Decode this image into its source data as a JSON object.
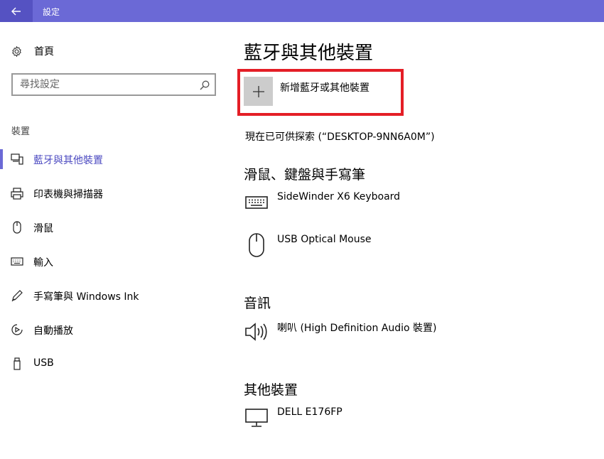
{
  "window": {
    "title": "設定",
    "back_icon": "arrow-left-icon"
  },
  "sidebar": {
    "home_label": "首頁",
    "search_placeholder": "尋找設定",
    "section_label": "裝置",
    "items": [
      {
        "label": "藍牙與其他裝置",
        "icon": "bluetooth-devices-icon",
        "active": true
      },
      {
        "label": "印表機與掃描器",
        "icon": "printer-icon",
        "active": false
      },
      {
        "label": "滑鼠",
        "icon": "mouse-icon",
        "active": false
      },
      {
        "label": "輸入",
        "icon": "keyboard-icon",
        "active": false
      },
      {
        "label": "手寫筆與 Windows Ink",
        "icon": "pen-icon",
        "active": false
      },
      {
        "label": "自動播放",
        "icon": "autoplay-icon",
        "active": false
      },
      {
        "label": "USB",
        "icon": "usb-icon",
        "active": false
      }
    ]
  },
  "main": {
    "title": "藍牙與其他裝置",
    "add_device_label": "新增藍牙或其他裝置",
    "discoverable_text": "現在已可供探索 (“DESKTOP-9NN6A0M”)",
    "sections": [
      {
        "heading": "滑鼠、鍵盤與手寫筆",
        "devices": [
          {
            "name": "SideWinder X6 Keyboard",
            "icon": "keyboard-icon"
          },
          {
            "name": "USB Optical Mouse",
            "icon": "mouse-icon"
          }
        ]
      },
      {
        "heading": "音訊",
        "devices": [
          {
            "name": "喇叭 (High Definition Audio 裝置)",
            "icon": "speaker-icon"
          }
        ]
      },
      {
        "heading": "其他裝置",
        "devices": [
          {
            "name": "DELL E176FP",
            "icon": "monitor-icon"
          }
        ]
      }
    ]
  },
  "colors": {
    "accent": "#6b69d6",
    "highlight": "#e41e26"
  }
}
